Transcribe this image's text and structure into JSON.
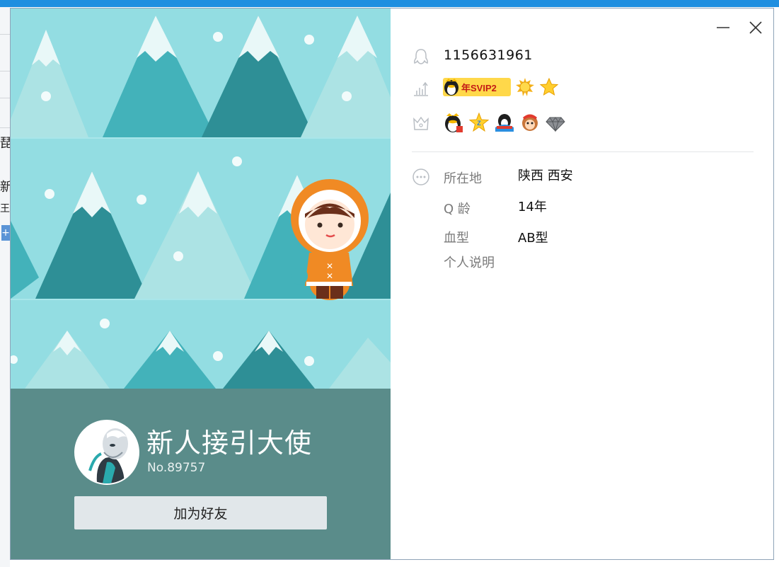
{
  "background": {
    "fragments": [
      "琵",
      "新",
      "王"
    ]
  },
  "profile": {
    "nickname": "新人接引大使",
    "number_label": "No.89757",
    "add_friend_label": "加为好友"
  },
  "info": {
    "qq_number": "1156631961",
    "vip_badge_text": "年SVIP2",
    "level_icons": [
      "sun-medal-icon",
      "star-icon"
    ],
    "privilege_icons": [
      "penguin-badge-icon",
      "level-star-icon",
      "penguin-game-icon",
      "monkey-icon",
      "diamond-icon"
    ],
    "fields": [
      {
        "label": "所在地",
        "value": "陕西 西安"
      },
      {
        "label": "Q 龄",
        "value": "14年"
      },
      {
        "label": "血型",
        "value": "AB型"
      },
      {
        "label": "个人说明",
        "value": ""
      }
    ]
  },
  "colors": {
    "panel": "#5a8c8a",
    "sky": "#93dde2",
    "button": "#e1e7ea",
    "accent_orange": "#f08a24"
  }
}
